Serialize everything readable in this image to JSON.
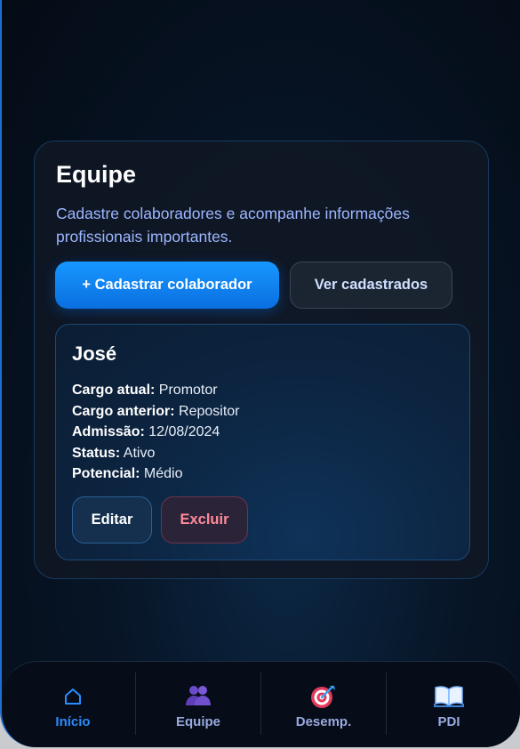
{
  "team": {
    "title": "Equipe",
    "subtitle": "Cadastre colaboradores e acompanhe informações profissionais importantes.",
    "add_button": "+ Cadastrar colaborador",
    "view_button": "Ver cadastrados"
  },
  "employee": {
    "name": "José",
    "fields": [
      {
        "label": "Cargo atual:",
        "value": "Promotor"
      },
      {
        "label": "Cargo anterior:",
        "value": "Repositor"
      },
      {
        "label": "Admissão:",
        "value": "12/08/2024"
      },
      {
        "label": "Status:",
        "value": "Ativo"
      },
      {
        "label": "Potencial:",
        "value": "Médio"
      }
    ],
    "edit_button": "Editar",
    "delete_button": "Excluir"
  },
  "nav": {
    "items": [
      {
        "label": "Início",
        "icon": "home-icon",
        "active": true
      },
      {
        "label": "Equipe",
        "icon": "people-icon",
        "active": false
      },
      {
        "label": "Desemp.",
        "icon": "target-icon",
        "active": false
      },
      {
        "label": "PDI",
        "icon": "book-icon",
        "active": false
      }
    ]
  },
  "colors": {
    "accent": "#1797ff",
    "danger": "#ff8a9a",
    "subtitle": "#9db6ff"
  }
}
